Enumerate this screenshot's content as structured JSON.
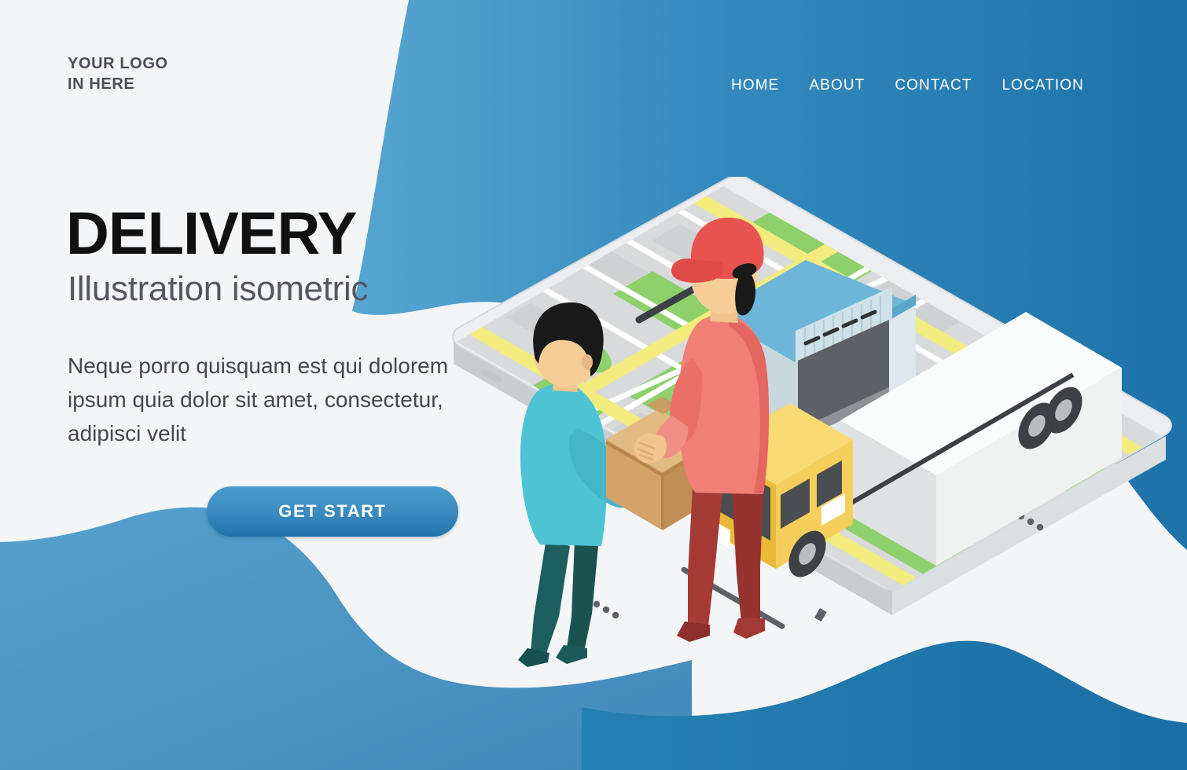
{
  "brand": {
    "logo_line1": "YOUR LOGO",
    "logo_line2": "IN HERE"
  },
  "nav": {
    "items": [
      {
        "label": "HOME"
      },
      {
        "label": "ABOUT"
      },
      {
        "label": "CONTACT"
      },
      {
        "label": "LOCATION"
      }
    ]
  },
  "hero": {
    "title": "DELIVERY",
    "subtitle": "Illustration isometric",
    "body": "Neque porro quisquam est qui dolorem ipsum quia dolor sit amet, consectetur, adipisci velit",
    "cta_label": "GET START"
  },
  "illustration": {
    "alt": "isometric-delivery-scene",
    "elements": [
      "tablet-map-device",
      "city-map",
      "warehouse-building",
      "delivery-truck",
      "courier-character",
      "customer-character",
      "cardboard-parcel"
    ]
  },
  "colors": {
    "page_background": "#f4f5f7",
    "header_wave_light": "#4a9cca",
    "header_wave_dark": "#1f77ad",
    "bottom_wave_left": "#4d95c8",
    "bottom_wave_right": "#1f7aad",
    "title_text": "#111111",
    "subtitle_text": "#53585e",
    "body_text": "#43484e",
    "logo_text": "#4a4f55",
    "cta_gradient_top": "#4a9ccd",
    "cta_gradient_bottom": "#1f72a8",
    "nav_text": "#ffffff",
    "map_road_yellow": "#f0e87a",
    "map_green": "#8cd06a",
    "map_block_gray": "#d8d8d8",
    "warehouse_roof": "#6bb4d8",
    "warehouse_wall": "#c3d4dd",
    "truck_cab": "#f5c842",
    "truck_box": "#eceded",
    "courier_cap": "#e8534f",
    "courier_shirt": "#f07f76",
    "courier_pants": "#a63a35",
    "customer_shirt": "#4ec3d4",
    "customer_pants": "#1d5c5c",
    "parcel": "#d8a96e"
  }
}
